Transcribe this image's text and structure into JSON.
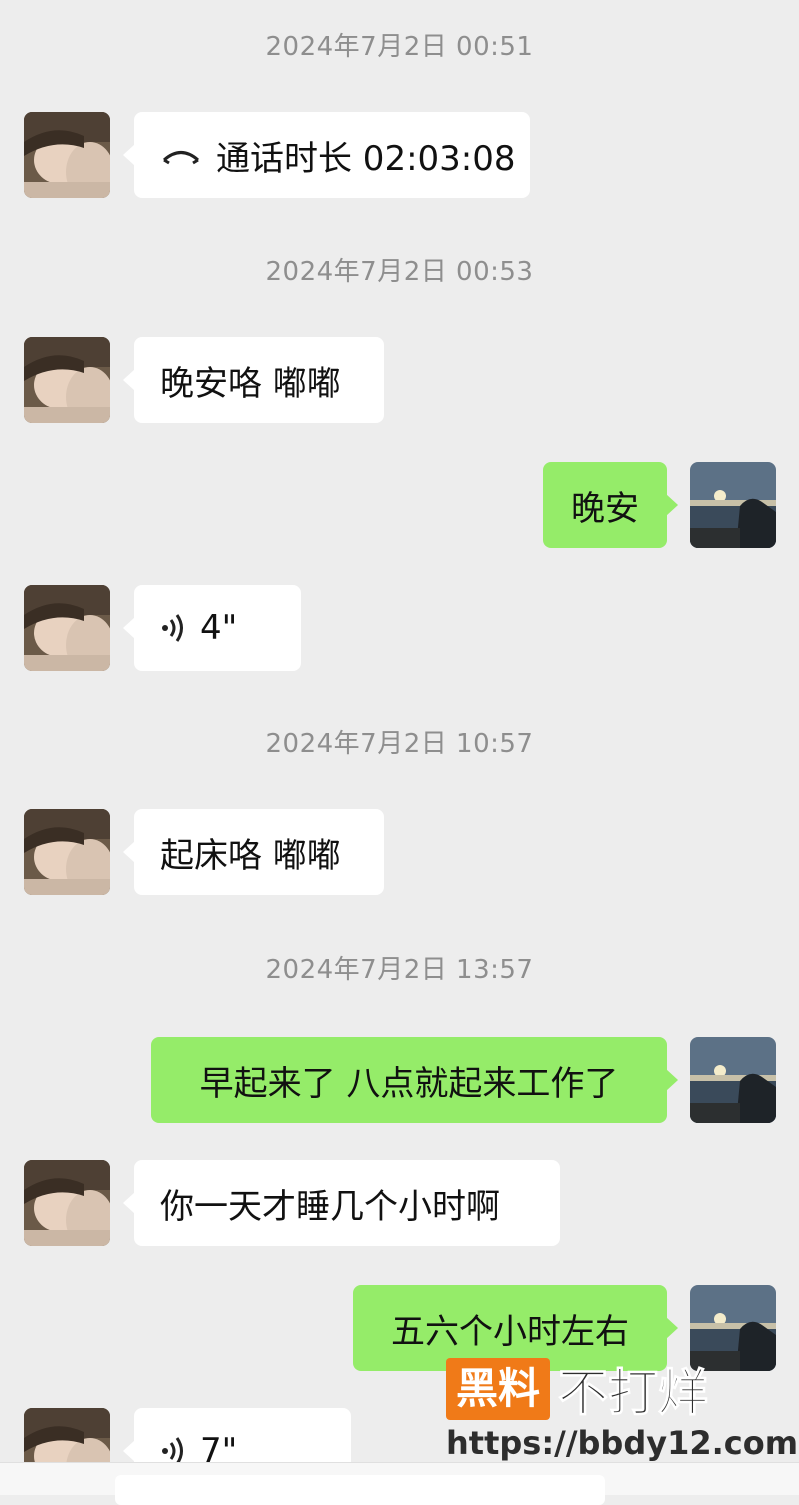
{
  "timestamps": [
    "2024年7月2日 00:51",
    "2024年7月2日 00:53",
    "2024年7月2日 10:57",
    "2024年7月2日 13:57"
  ],
  "messages": {
    "call": {
      "label": "通话时长 02:03:08",
      "icon": "phone-hangup-icon"
    },
    "m1": "晚安咯 嘟嘟",
    "m2": "晚安",
    "voice1": {
      "duration": "4\"",
      "icon": "voice-icon"
    },
    "m3": "起床咯 嘟嘟",
    "m4": "早起来了 八点就起来工作了",
    "m5": "你一天才睡几个小时啊",
    "m6": "五六个小时左右",
    "voice2": {
      "duration": "7\"",
      "icon": "voice-icon"
    }
  },
  "watermark": {
    "highlight": "黑料",
    "rest": "不打烊",
    "url": "https://bbdy12.com"
  },
  "colors": {
    "background": "#ededed",
    "outgoing_bubble": "#95ec69",
    "incoming_bubble": "#ffffff",
    "timestamp": "#8e8e8e",
    "watermark_accent": "#f07a18"
  }
}
